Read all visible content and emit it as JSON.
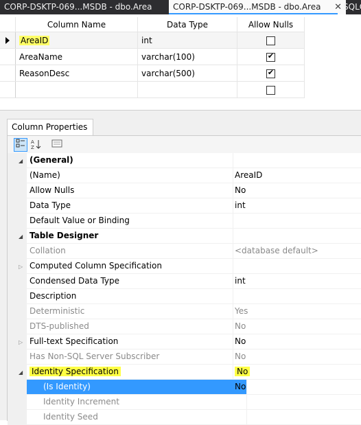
{
  "tabs": [
    {
      "label": "CORP-DSKTP-069...MSDB - dbo.Area",
      "state": "inactive"
    },
    {
      "label": "CORP-DSKTP-069...MSDB - dbo.Area",
      "state": "active",
      "close": "✕"
    },
    {
      "label": "SQLQ",
      "state": "partial"
    }
  ],
  "grid": {
    "columns": [
      "Column Name",
      "Data Type",
      "Allow Nulls"
    ],
    "rows": [
      {
        "name": "AreaID",
        "type": "int",
        "allow_nulls": false,
        "current": true,
        "highlight": true
      },
      {
        "name": "AreaName",
        "type": "varchar(100)",
        "allow_nulls": true
      },
      {
        "name": "ReasonDesc",
        "type": "varchar(500)",
        "allow_nulls": true
      },
      {
        "name": "",
        "type": "",
        "allow_nulls": false
      }
    ]
  },
  "properties_panel": {
    "tab_label": "Column Properties",
    "toolbar": [
      "categorized-icon",
      "alphabetical-icon",
      "property-pages-icon"
    ],
    "rows": [
      {
        "name": "(General)",
        "value": "",
        "kind": "category",
        "expanded": true
      },
      {
        "name": "(Name)",
        "value": "AreaID"
      },
      {
        "name": "Allow Nulls",
        "value": "No"
      },
      {
        "name": "Data Type",
        "value": "int"
      },
      {
        "name": "Default Value or Binding",
        "value": ""
      },
      {
        "name": "Table Designer",
        "value": "",
        "kind": "category",
        "expanded": true
      },
      {
        "name": "Collation",
        "value": "<database default>",
        "disabled": true
      },
      {
        "name": "Computed Column Specification",
        "value": "",
        "expandable": true
      },
      {
        "name": "Condensed Data Type",
        "value": "int"
      },
      {
        "name": "Description",
        "value": ""
      },
      {
        "name": "Deterministic",
        "value": "Yes",
        "disabled": true
      },
      {
        "name": "DTS-published",
        "value": "No",
        "disabled": true
      },
      {
        "name": "Full-text Specification",
        "value": "No",
        "expandable": true
      },
      {
        "name": "Has Non-SQL Server Subscriber",
        "value": "No",
        "disabled": true
      },
      {
        "name": "Identity Specification",
        "value": "No",
        "expanded": true,
        "highlight": true
      },
      {
        "name": "(Is Identity)",
        "value": "No",
        "child": true,
        "selected": true
      },
      {
        "name": "Identity Increment",
        "value": "",
        "child": true,
        "disabled": true
      },
      {
        "name": "Identity Seed",
        "value": "",
        "child": true,
        "disabled": true
      }
    ]
  },
  "colors": {
    "tabbar_bg": "#2d2d30",
    "accent": "#3399ff",
    "highlight": "#ffff44",
    "selection": "#3399ff"
  }
}
